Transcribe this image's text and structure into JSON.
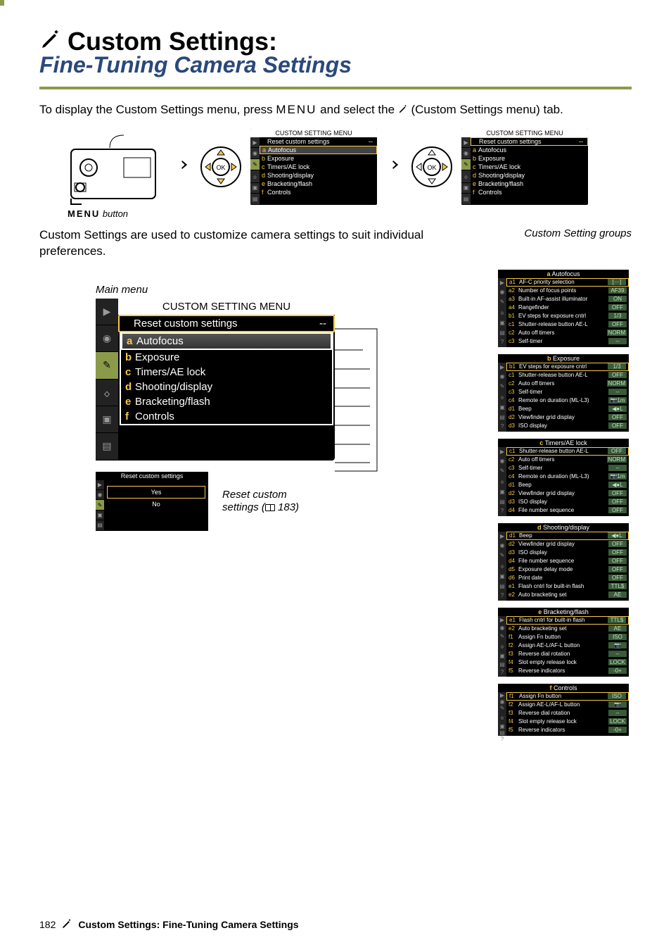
{
  "page": {
    "title": "Custom Settings:",
    "subtitle": "Fine-Tuning Camera Settings",
    "intro_1": "To display the Custom Settings menu, press ",
    "intro_menu": "MENU",
    "intro_2": " and select the ",
    "intro_3": " (Custom Settings menu) tab.",
    "menu_button_label": "MENU",
    "menu_button_caption": " button",
    "desc": "Custom Settings are used to customize camera settings to suit individual preferences.",
    "groups_label": "Custom Setting groups",
    "main_menu_label": "Main menu",
    "reset_caption_1": "Reset custom",
    "reset_caption_2": "settings (",
    "reset_caption_3": " 183)",
    "page_number": "182",
    "footer_title": "Custom Settings: Fine-Tuning Camera Settings"
  },
  "small_menu": {
    "header": "CUSTOM SETTING MENU",
    "rows": [
      {
        "letter": "",
        "text": "Reset custom settings",
        "val": "--"
      },
      {
        "letter": "a",
        "text": "Autofocus",
        "val": ""
      },
      {
        "letter": "b",
        "text": "Exposure",
        "val": ""
      },
      {
        "letter": "c",
        "text": "Timers/AE lock",
        "val": ""
      },
      {
        "letter": "d",
        "text": "Shooting/display",
        "val": ""
      },
      {
        "letter": "e",
        "text": "Bracketing/flash",
        "val": ""
      },
      {
        "letter": "f",
        "text": "Controls",
        "val": ""
      }
    ]
  },
  "big_menu": {
    "header": "CUSTOM SETTING MENU",
    "rows": [
      {
        "letter": "",
        "text": "Reset custom settings",
        "val": "--",
        "sel": true
      },
      {
        "letter": "a",
        "text": "Autofocus",
        "val": "",
        "high": true
      },
      {
        "letter": "b",
        "text": "Exposure",
        "val": ""
      },
      {
        "letter": "c",
        "text": "Timers/AE lock",
        "val": ""
      },
      {
        "letter": "d",
        "text": "Shooting/display",
        "val": ""
      },
      {
        "letter": "e",
        "text": "Bracketing/flash",
        "val": ""
      },
      {
        "letter": "f",
        "text": "Controls",
        "val": ""
      }
    ]
  },
  "reset_menu": {
    "header": "Reset custom settings",
    "rows": [
      {
        "text": "Yes",
        "sel": true
      },
      {
        "text": "No",
        "sel": false
      }
    ]
  },
  "groups": [
    {
      "letter": "a",
      "title": "Autofocus",
      "rows": [
        {
          "code": "a1",
          "text": "AF-C priority selection",
          "val": "[···]",
          "sel": true
        },
        {
          "code": "a2",
          "text": "Number of focus points",
          "val": "AF39"
        },
        {
          "code": "a3",
          "text": "Built-in AF-assist illuminator",
          "val": "ON"
        },
        {
          "code": "a4",
          "text": "Rangefinder",
          "val": "OFF"
        },
        {
          "code": "b1",
          "text": "EV steps for exposure cntrl",
          "val": "1/3"
        },
        {
          "code": "c1",
          "text": "Shutter-release button AE-L",
          "val": "OFF"
        },
        {
          "code": "c2",
          "text": "Auto off timers",
          "val": "NORM"
        },
        {
          "code": "c3",
          "text": "Self-timer",
          "val": "--"
        }
      ]
    },
    {
      "letter": "b",
      "title": "Exposure",
      "rows": [
        {
          "code": "b1",
          "text": "EV steps for exposure cntrl",
          "val": "1/3",
          "sel": true
        },
        {
          "code": "c1",
          "text": "Shutter-release button AE-L",
          "val": "OFF"
        },
        {
          "code": "c2",
          "text": "Auto off timers",
          "val": "NORM"
        },
        {
          "code": "c3",
          "text": "Self-timer",
          "val": "--"
        },
        {
          "code": "c4",
          "text": "Remote on duration (ML-L3)",
          "val": "📷1m"
        },
        {
          "code": "d1",
          "text": "Beep",
          "val": "◀●L"
        },
        {
          "code": "d2",
          "text": "Viewfinder grid display",
          "val": "OFF"
        },
        {
          "code": "d3",
          "text": "ISO display",
          "val": "OFF"
        }
      ]
    },
    {
      "letter": "c",
      "title": "Timers/AE lock",
      "rows": [
        {
          "code": "c1",
          "text": "Shutter-release button AE-L",
          "val": "OFF",
          "sel": true
        },
        {
          "code": "c2",
          "text": "Auto off timers",
          "val": "NORM"
        },
        {
          "code": "c3",
          "text": "Self-timer",
          "val": "--"
        },
        {
          "code": "c4",
          "text": "Remote on duration (ML-L3)",
          "val": "📷1m"
        },
        {
          "code": "d1",
          "text": "Beep",
          "val": "◀●L"
        },
        {
          "code": "d2",
          "text": "Viewfinder grid display",
          "val": "OFF"
        },
        {
          "code": "d3",
          "text": "ISO display",
          "val": "OFF"
        },
        {
          "code": "d4",
          "text": "File number sequence",
          "val": "OFF"
        }
      ]
    },
    {
      "letter": "d",
      "title": "Shooting/display",
      "rows": [
        {
          "code": "d1",
          "text": "Beep",
          "val": "◀●L",
          "sel": true
        },
        {
          "code": "d2",
          "text": "Viewfinder grid display",
          "val": "OFF"
        },
        {
          "code": "d3",
          "text": "ISO display",
          "val": "OFF"
        },
        {
          "code": "d4",
          "text": "File number sequence",
          "val": "OFF"
        },
        {
          "code": "d5",
          "text": "Exposure delay mode",
          "val": "OFF"
        },
        {
          "code": "d6",
          "text": "Print date",
          "val": "OFF"
        },
        {
          "code": "e1",
          "text": "Flash cntrl for built-in flash",
          "val": "TTL$"
        },
        {
          "code": "e2",
          "text": "Auto bracketing set",
          "val": "AE"
        }
      ]
    },
    {
      "letter": "e",
      "title": "Bracketing/flash",
      "rows": [
        {
          "code": "e1",
          "text": "Flash cntrl for built-in flash",
          "val": "TTL$",
          "sel": true
        },
        {
          "code": "e2",
          "text": "Auto bracketing set",
          "val": "AE"
        },
        {
          "code": "f1",
          "text": "Assign Fn button",
          "val": "ISO"
        },
        {
          "code": "f2",
          "text": "Assign AE-L/AF-L button",
          "val": "📷"
        },
        {
          "code": "f3",
          "text": "Reverse dial rotation",
          "val": "--"
        },
        {
          "code": "f4",
          "text": "Slot empty release lock",
          "val": "LOCK"
        },
        {
          "code": "f5",
          "text": "Reverse indicators",
          "val": "-0+"
        }
      ]
    },
    {
      "letter": "f",
      "title": "Controls",
      "rows": [
        {
          "code": "f1",
          "text": "Assign Fn button",
          "val": "ISO",
          "sel": true
        },
        {
          "code": "f2",
          "text": "Assign AE-L/AF-L button",
          "val": "📷"
        },
        {
          "code": "f3",
          "text": "Reverse dial rotation",
          "val": "--"
        },
        {
          "code": "f4",
          "text": "Slot empty release lock",
          "val": "LOCK"
        },
        {
          "code": "f5",
          "text": "Reverse indicators",
          "val": "-0+"
        }
      ]
    }
  ]
}
